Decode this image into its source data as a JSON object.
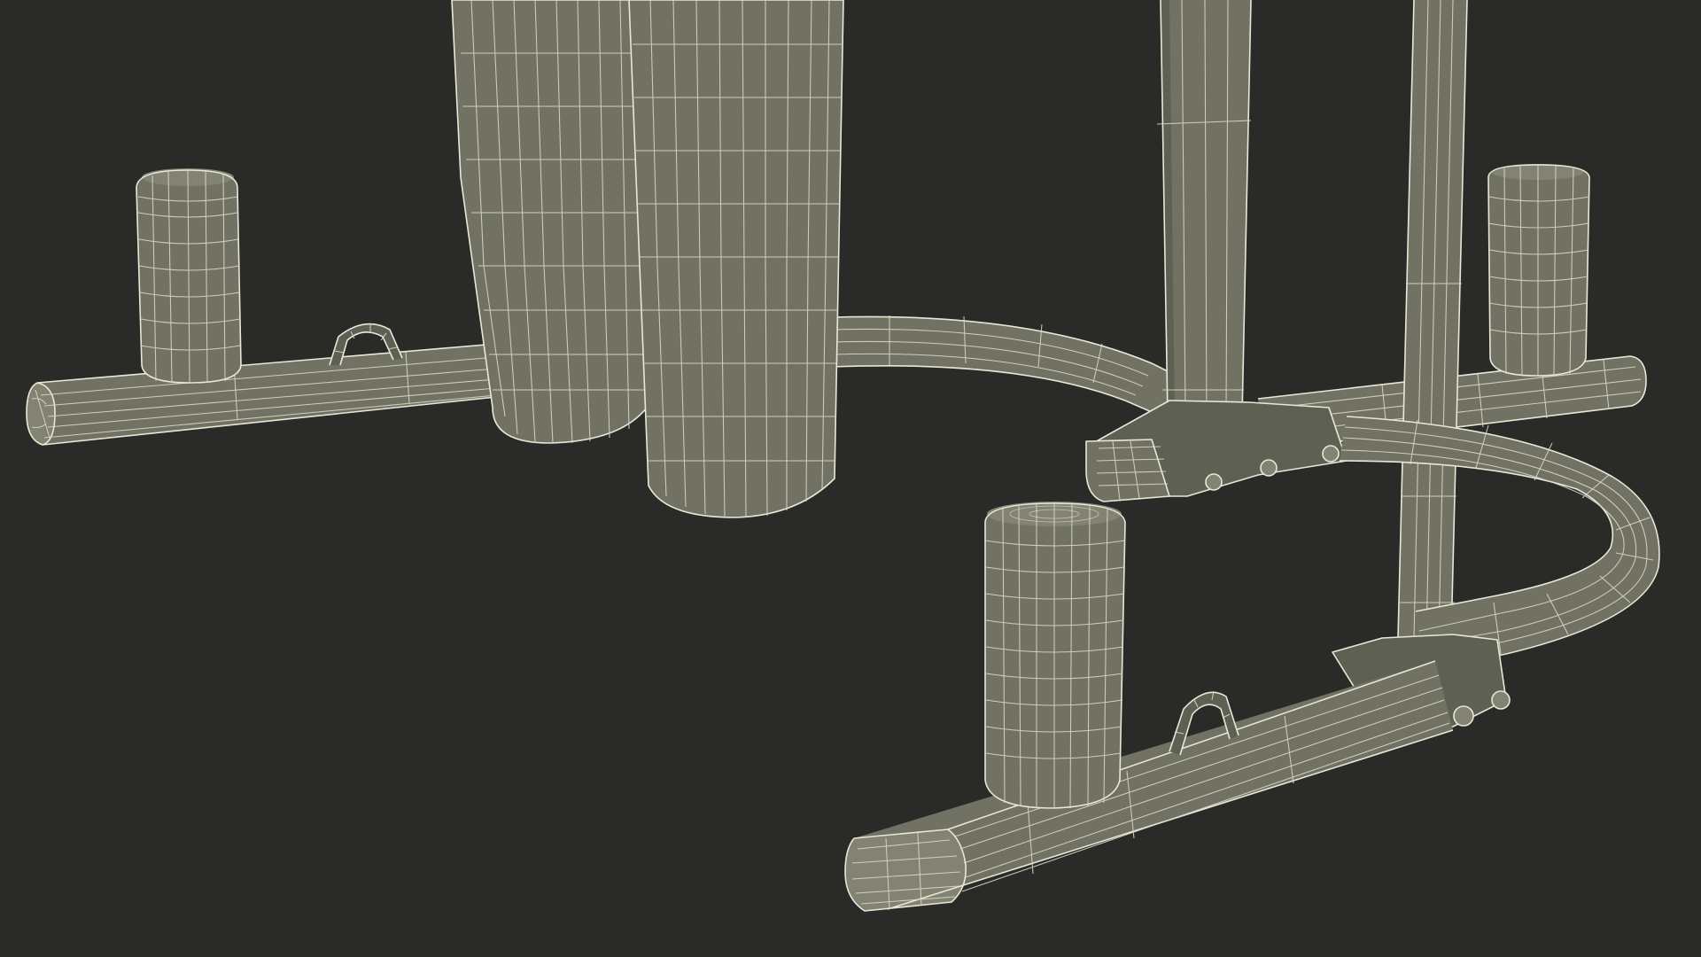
{
  "scene": {
    "subject": "",
    "background_color": "#2a2a29",
    "mesh_fill_color": "#717263",
    "wire_color": "#e9e8d6",
    "text": []
  }
}
